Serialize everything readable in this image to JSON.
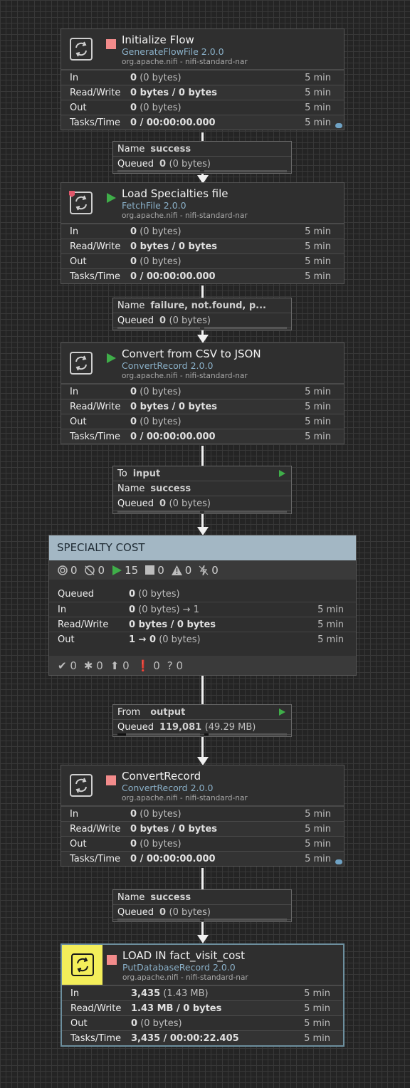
{
  "processors": [
    {
      "title": "Initialize Flow",
      "type": "GenerateFlowFile 2.0.0",
      "bundle": "org.apache.nifi - nifi-standard-nar",
      "state": "stopped",
      "stats": {
        "in_label": "In",
        "in_count": "0",
        "in_size": "(0 bytes)",
        "in_time": "5 min",
        "rw_label": "Read/Write",
        "rw_value": "0 bytes / 0 bytes",
        "rw_time": "5 min",
        "out_label": "Out",
        "out_count": "0",
        "out_size": "(0 bytes)",
        "out_time": "5 min",
        "tasks_label": "Tasks/Time",
        "tasks_value": "0 / 00:00:00.000",
        "tasks_time": "5 min"
      }
    },
    {
      "title": "Load Specialties file",
      "type": "FetchFile 2.0.0",
      "bundle": "org.apache.nifi - nifi-standard-nar",
      "state": "running",
      "stats": {
        "in_label": "In",
        "in_count": "0",
        "in_size": "(0 bytes)",
        "in_time": "5 min",
        "rw_label": "Read/Write",
        "rw_value": "0 bytes / 0 bytes",
        "rw_time": "5 min",
        "out_label": "Out",
        "out_count": "0",
        "out_size": "(0 bytes)",
        "out_time": "5 min",
        "tasks_label": "Tasks/Time",
        "tasks_value": "0 / 00:00:00.000",
        "tasks_time": "5 min"
      }
    },
    {
      "title": "Convert from CSV to JSON",
      "type": "ConvertRecord 2.0.0",
      "bundle": "org.apache.nifi - nifi-standard-nar",
      "state": "running",
      "stats": {
        "in_label": "In",
        "in_count": "0",
        "in_size": "(0 bytes)",
        "in_time": "5 min",
        "rw_label": "Read/Write",
        "rw_value": "0 bytes / 0 bytes",
        "rw_time": "5 min",
        "out_label": "Out",
        "out_count": "0",
        "out_size": "(0 bytes)",
        "out_time": "5 min",
        "tasks_label": "Tasks/Time",
        "tasks_value": "0 / 00:00:00.000",
        "tasks_time": "5 min"
      }
    },
    {
      "title": "ConvertRecord",
      "type": "ConvertRecord 2.0.0",
      "bundle": "org.apache.nifi - nifi-standard-nar",
      "state": "stopped",
      "stats": {
        "in_label": "In",
        "in_count": "0",
        "in_size": "(0 bytes)",
        "in_time": "5 min",
        "rw_label": "Read/Write",
        "rw_value": "0 bytes / 0 bytes",
        "rw_time": "5 min",
        "out_label": "Out",
        "out_count": "0",
        "out_size": "(0 bytes)",
        "out_time": "5 min",
        "tasks_label": "Tasks/Time",
        "tasks_value": "0 / 00:00:00.000",
        "tasks_time": "5 min"
      }
    },
    {
      "title": "LOAD IN fact_visit_cost",
      "type": "PutDatabaseRecord 2.0.0",
      "bundle": "org.apache.nifi - nifi-standard-nar",
      "state": "stopped",
      "stats": {
        "in_label": "In",
        "in_count": "3,435",
        "in_size": "(1.43 MB)",
        "in_time": "5 min",
        "rw_label": "Read/Write",
        "rw_value": "1.43 MB / 0 bytes",
        "rw_time": "5 min",
        "out_label": "Out",
        "out_count": "0",
        "out_size": "(0 bytes)",
        "out_time": "5 min",
        "tasks_label": "Tasks/Time",
        "tasks_value": "3,435 / 00:00:22.405",
        "tasks_time": "5 min"
      }
    }
  ],
  "connections": [
    {
      "name_label": "Name",
      "name": "success",
      "queued_label": "Queued",
      "queued_count": "0",
      "queued_size": "(0 bytes)"
    },
    {
      "name_label": "Name",
      "name": "failure, not.found, p...",
      "queued_label": "Queued",
      "queued_count": "0",
      "queued_size": "(0 bytes)"
    },
    {
      "to_label": "To",
      "to": "input",
      "name_label": "Name",
      "name": "success",
      "queued_label": "Queued",
      "queued_count": "0",
      "queued_size": "(0 bytes)"
    },
    {
      "from_label": "From",
      "from": "output",
      "queued_label": "Queued",
      "queued_count": "119,081",
      "queued_size": "(49.29 MB)"
    },
    {
      "name_label": "Name",
      "name": "success",
      "queued_label": "Queued",
      "queued_count": "0",
      "queued_size": "(0 bytes)"
    }
  ],
  "process_group": {
    "title": "SPECIALTY COST",
    "counts": {
      "transmitting": "0",
      "not_transmitting": "0",
      "running": "15",
      "stopped": "0",
      "invalid": "0",
      "disabled": "0"
    },
    "rows": {
      "queued_label": "Queued",
      "queued_count": "0",
      "queued_size": "(0 bytes)",
      "in_label": "In",
      "in_count": "0",
      "in_rest": "(0 bytes) → 1",
      "in_time": "5 min",
      "rw_label": "Read/Write",
      "rw_value": "0 bytes / 0 bytes",
      "rw_time": "5 min",
      "out_label": "Out",
      "out_count": "1 → 0",
      "out_size": "(0 bytes)",
      "out_time": "5 min"
    },
    "versions": {
      "up_to_date": "0",
      "locally_modified": "0",
      "stale": "0",
      "modified_stale": "0",
      "sync_failure": "0"
    }
  },
  "colors": {
    "running": "#3fae49",
    "stopped": "#f28b8b",
    "pg_header": "#a3b7c4",
    "selected_icon_bg": "#f3ee5a",
    "type_text": "#8ab0c8"
  }
}
